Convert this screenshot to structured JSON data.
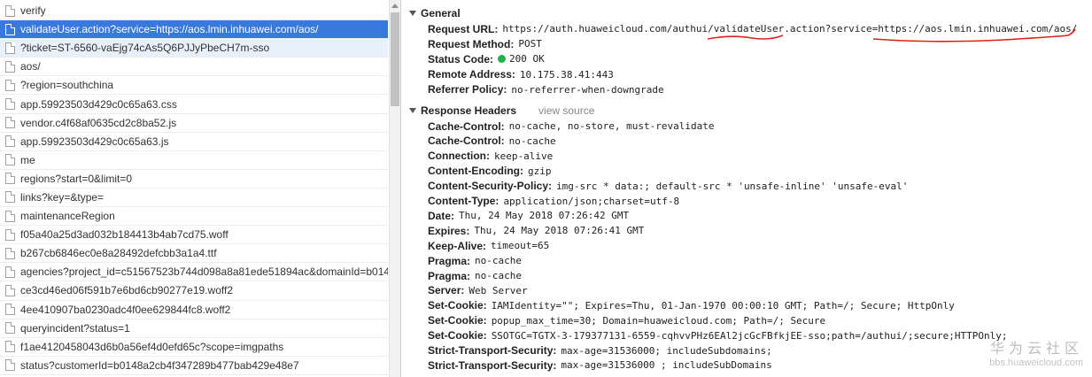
{
  "requests": [
    {
      "name": "verify",
      "state": "normal"
    },
    {
      "name": "validateUser.action?service=https://aos.lmin.inhuawei.com/aos/",
      "state": "selected"
    },
    {
      "name": "?ticket=ST-6560-vaEjg74cAs5Q6PJJyPbeCH7m-sso",
      "state": "sub"
    },
    {
      "name": "aos/",
      "state": "normal"
    },
    {
      "name": "?region=southchina",
      "state": "normal"
    },
    {
      "name": "app.59923503d429c0c65a63.css",
      "state": "normal"
    },
    {
      "name": "vendor.c4f68af0635cd2c8ba52.js",
      "state": "normal"
    },
    {
      "name": "app.59923503d429c0c65a63.js",
      "state": "normal"
    },
    {
      "name": "me",
      "state": "normal"
    },
    {
      "name": "regions?start=0&limit=0",
      "state": "normal"
    },
    {
      "name": "links?key=&type=",
      "state": "normal"
    },
    {
      "name": "maintenanceRegion",
      "state": "normal"
    },
    {
      "name": "f05a40a25d3ad032b184413b4ab7cd75.woff",
      "state": "normal"
    },
    {
      "name": "b267cb6846ec0e8a28492defcbb3a1a4.ttf",
      "state": "normal"
    },
    {
      "name": "agencies?project_id=c51567523b744d098a8a81ede51894ac&domainId=b014...",
      "state": "normal"
    },
    {
      "name": "ce3cd46ed06f591b7e6bd6cb90277e19.woff2",
      "state": "normal"
    },
    {
      "name": "4ee410907ba0230adc4f0ee629844fc8.woff2",
      "state": "normal"
    },
    {
      "name": "queryincident?status=1",
      "state": "normal"
    },
    {
      "name": "f1ae4120458043d6b0a56ef4d0efd65c?scope=imgpaths",
      "state": "normal"
    },
    {
      "name": "status?customerId=b0148a2cb4f347289b477bab429e48e7",
      "state": "normal"
    }
  ],
  "general": {
    "title": "General",
    "items": [
      {
        "key": "Request URL:",
        "value": "https://auth.huaweicloud.com/authui/validateUser.action?service=https://aos.lmin.inhuawei.com/aos/"
      },
      {
        "key": "Request Method:",
        "value": "POST"
      },
      {
        "key": "Status Code:",
        "value": "200 OK",
        "status_color": "#20b24a"
      },
      {
        "key": "Remote Address:",
        "value": "10.175.38.41:443"
      },
      {
        "key": "Referrer Policy:",
        "value": "no-referrer-when-downgrade"
      }
    ]
  },
  "response_headers": {
    "title": "Response Headers",
    "view_source": "view source",
    "items": [
      {
        "key": "Cache-Control:",
        "value": "no-cache, no-store, must-revalidate"
      },
      {
        "key": "Cache-Control:",
        "value": "no-cache"
      },
      {
        "key": "Connection:",
        "value": "keep-alive"
      },
      {
        "key": "Content-Encoding:",
        "value": "gzip"
      },
      {
        "key": "Content-Security-Policy:",
        "value": "img-src * data:; default-src * 'unsafe-inline' 'unsafe-eval'"
      },
      {
        "key": "Content-Type:",
        "value": "application/json;charset=utf-8"
      },
      {
        "key": "Date:",
        "value": "Thu, 24 May 2018 07:26:42 GMT"
      },
      {
        "key": "Expires:",
        "value": "Thu, 24 May 2018 07:26:41 GMT"
      },
      {
        "key": "Keep-Alive:",
        "value": "timeout=65"
      },
      {
        "key": "Pragma:",
        "value": "no-cache"
      },
      {
        "key": "Pragma:",
        "value": "no-cache"
      },
      {
        "key": "Server:",
        "value": "Web Server"
      },
      {
        "key": "Set-Cookie:",
        "value": "IAMIdentity=\"\"; Expires=Thu, 01-Jan-1970 00:00:10 GMT; Path=/; Secure; HttpOnly"
      },
      {
        "key": "Set-Cookie:",
        "value": "popup_max_time=30; Domain=huaweicloud.com; Path=/; Secure"
      },
      {
        "key": "Set-Cookie:",
        "value": "SSOTGC=TGTX-3-179377131-6559-cqhvvPHz6EAl2jcGcFBfkjEE-sso;path=/authui/;secure;HTTPOnly;"
      },
      {
        "key": "Strict-Transport-Security:",
        "value": "max-age=31536000; includeSubdomains;"
      },
      {
        "key": "Strict-Transport-Security:",
        "value": "max-age=31536000 ; includeSubDomains"
      }
    ]
  },
  "watermark": {
    "cn": "华为云社区",
    "url": "bbs.huaweicloud.com"
  },
  "annotation_color": "#e0201b"
}
